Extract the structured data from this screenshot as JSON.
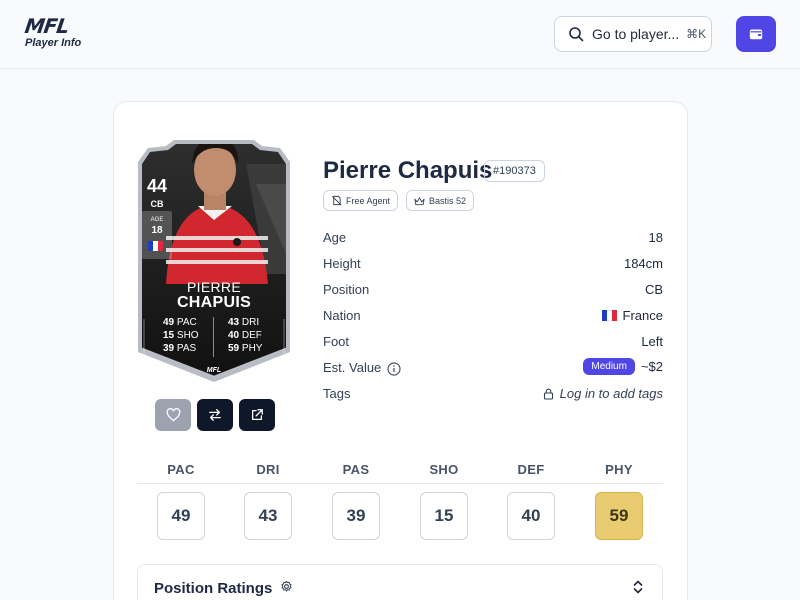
{
  "header": {
    "logo_text": "MFL",
    "logo_subtitle": "Player Info",
    "search_label": "Go to player...",
    "search_shortcut": "⌘K",
    "search_icon": "search-icon",
    "wallet_icon": "wallet-icon"
  },
  "card": {
    "overall": "44",
    "position": "CB",
    "age_label": "AGE",
    "age": "18",
    "first_name": "PIERRE",
    "last_name": "CHAPUIS",
    "stats_left": [
      {
        "value": "49",
        "label": "PAC"
      },
      {
        "value": "15",
        "label": "SHO"
      },
      {
        "value": "39",
        "label": "PAS"
      }
    ],
    "stats_right": [
      {
        "value": "43",
        "label": "DRI"
      },
      {
        "value": "40",
        "label": "DEF"
      },
      {
        "value": "59",
        "label": "PHY"
      }
    ],
    "brand": "MFL"
  },
  "actions": {
    "favorite_icon": "heart-icon",
    "compare_icon": "swap-arrows-icon",
    "external_icon": "external-link-icon"
  },
  "player": {
    "name": "Pierre Chapuis",
    "id": "#190373",
    "badges": [
      {
        "label": "Free Agent",
        "icon": "no-contract-icon"
      },
      {
        "label": "Bastis 52",
        "icon": "crown-icon"
      }
    ]
  },
  "info": {
    "age_label": "Age",
    "age": "18",
    "height_label": "Height",
    "height": "184cm",
    "position_label": "Position",
    "position": "CB",
    "nation_label": "Nation",
    "nation": "France",
    "foot_label": "Foot",
    "foot": "Left",
    "value_label": "Est. Value",
    "value_badge": "Medium",
    "value": "~$2",
    "tags_label": "Tags",
    "tags_value": "Log in to add tags"
  },
  "stats": [
    {
      "label": "PAC",
      "value": "49"
    },
    {
      "label": "DRI",
      "value": "43"
    },
    {
      "label": "PAS",
      "value": "39"
    },
    {
      "label": "SHO",
      "value": "15"
    },
    {
      "label": "DEF",
      "value": "40"
    },
    {
      "label": "PHY",
      "value": "59"
    }
  ],
  "position_ratings": {
    "title": "Position Ratings"
  },
  "colors": {
    "accent": "#4f46e5",
    "highlight_stat": "#e9cc72",
    "card_dark": "#1c1c1c",
    "jersey_red": "#d0282e"
  }
}
